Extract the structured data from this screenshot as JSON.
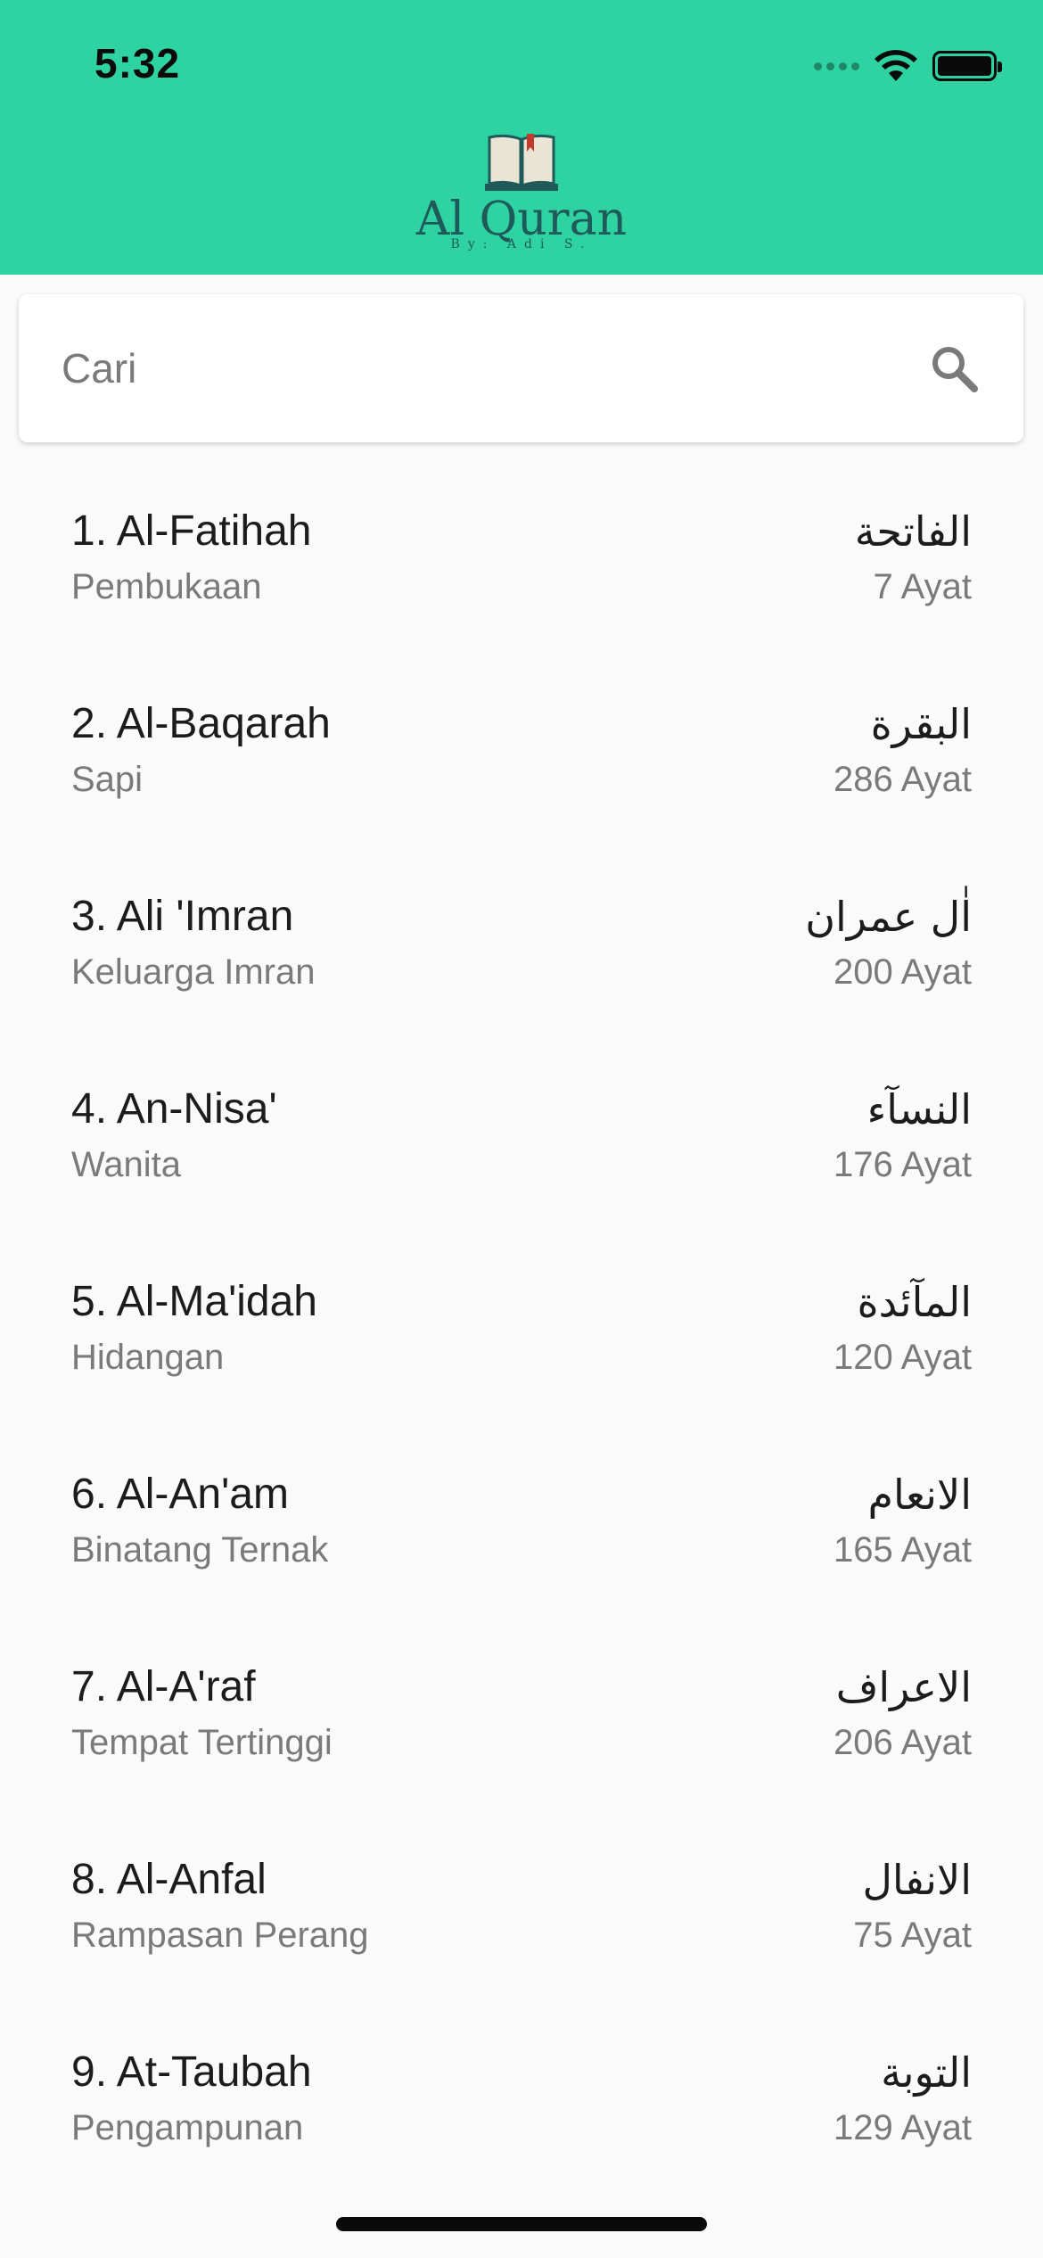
{
  "status_bar": {
    "time": "5:32"
  },
  "header": {
    "title": "Al Quran",
    "subtitle": "By: Adi S."
  },
  "search": {
    "placeholder": "Cari"
  },
  "surahs": [
    {
      "name": "1. Al-Fatihah",
      "meaning": "Pembukaan",
      "arabic": "الفاتحة",
      "ayat": "7 Ayat"
    },
    {
      "name": "2. Al-Baqarah",
      "meaning": "Sapi",
      "arabic": "البقرة",
      "ayat": "286 Ayat"
    },
    {
      "name": "3. Ali 'Imran",
      "meaning": "Keluarga Imran",
      "arabic": "اٰل عمران",
      "ayat": "200 Ayat"
    },
    {
      "name": "4. An-Nisa'",
      "meaning": "Wanita",
      "arabic": "النسآء",
      "ayat": "176 Ayat"
    },
    {
      "name": "5. Al-Ma'idah",
      "meaning": "Hidangan",
      "arabic": "المآئدة",
      "ayat": "120 Ayat"
    },
    {
      "name": "6. Al-An'am",
      "meaning": "Binatang Ternak",
      "arabic": "الانعام",
      "ayat": "165 Ayat"
    },
    {
      "name": "7. Al-A'raf",
      "meaning": "Tempat Tertinggi",
      "arabic": "الاعراف",
      "ayat": "206 Ayat"
    },
    {
      "name": "8. Al-Anfal",
      "meaning": "Rampasan Perang",
      "arabic": "الانفال",
      "ayat": "75 Ayat"
    },
    {
      "name": "9. At-Taubah",
      "meaning": "Pengampunan",
      "arabic": "التوبة",
      "ayat": "129 Ayat"
    }
  ],
  "colors": {
    "header_bg": "#2fd3a2",
    "logo_text": "#1f5a5a",
    "page_bg": "#fafafa"
  },
  "icons": {
    "search": "search-icon",
    "book": "book-icon",
    "wifi": "wifi-icon",
    "battery": "battery-icon",
    "signal": "signal-icon"
  }
}
